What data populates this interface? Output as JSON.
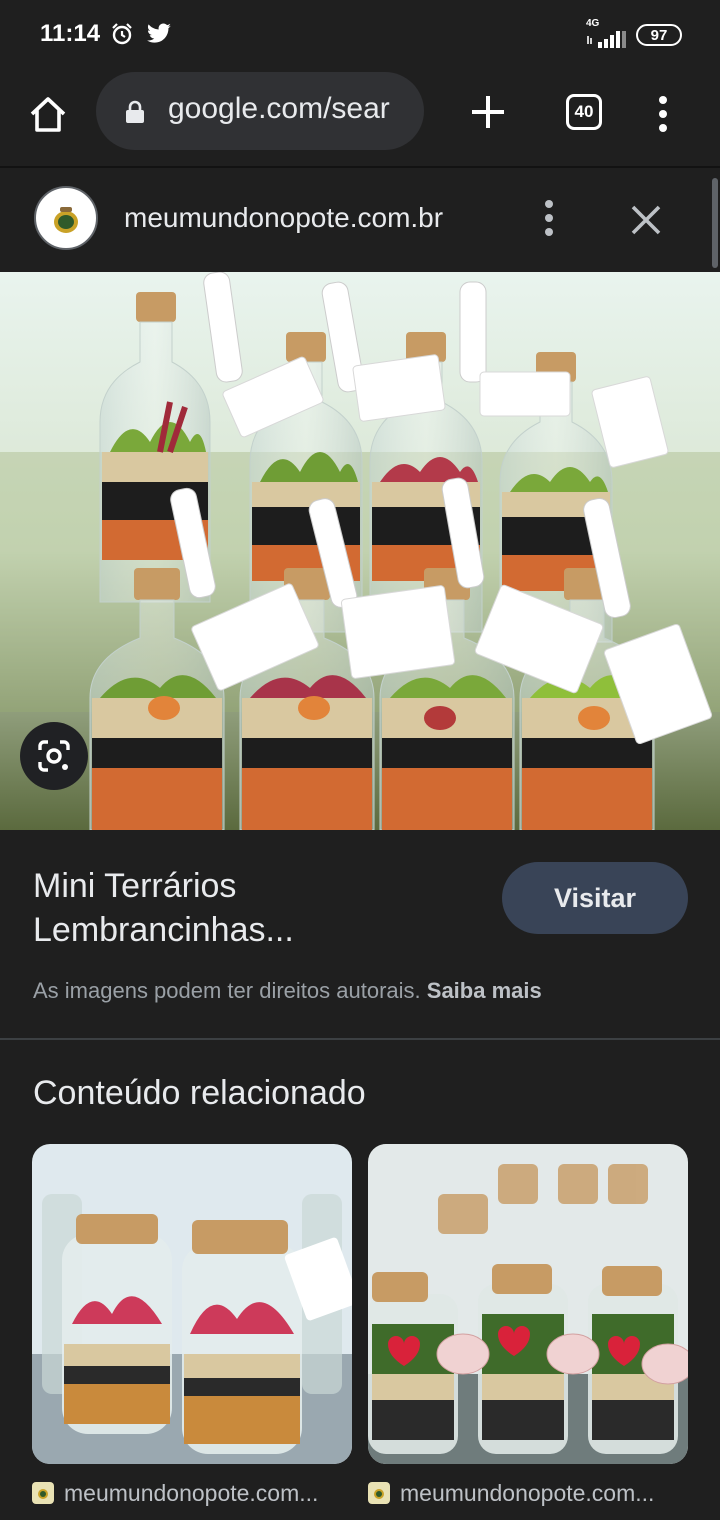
{
  "status_bar": {
    "time": "11:14",
    "network": "4G",
    "battery": "97"
  },
  "browser": {
    "url": "google.com/sear",
    "tab_count": "40"
  },
  "source": {
    "domain": "meumundonopote.com.br"
  },
  "result": {
    "title": "Mini Terrários Lembrancinhas...",
    "visit_label": "Visitar",
    "copyright_text": "As imagens podem ter direitos autorais.",
    "learn_more": "Saiba mais"
  },
  "related": {
    "heading": "Conteúdo relacionado",
    "items": [
      {
        "domain": "meumundonopote.com..."
      },
      {
        "domain": "meumundonopote.com..."
      }
    ]
  },
  "colors": {
    "background": "#1f1f1f",
    "visit_button": "#394457",
    "omnibox": "#303134"
  }
}
